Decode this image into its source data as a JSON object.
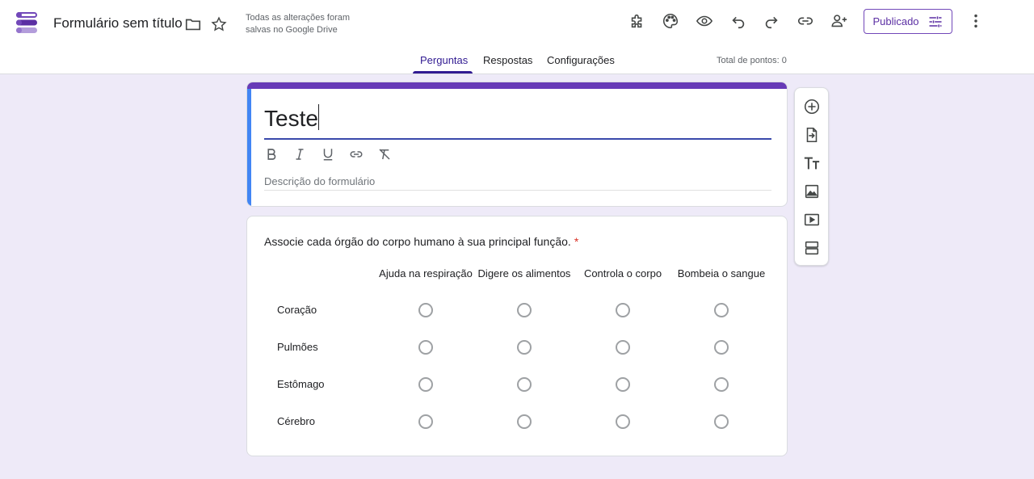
{
  "header": {
    "title": "Formulário sem título",
    "save_status": "Todas as alterações foram salvas no Google Drive",
    "publish_label": "Publicado",
    "icons": [
      "forms-logo-icon",
      "folder-icon",
      "star-icon",
      "addon-icon",
      "palette-icon",
      "preview-icon",
      "undo-icon",
      "redo-icon",
      "link-icon",
      "add-collaborator-icon",
      "settings-sliders-icon",
      "more-vert-icon"
    ],
    "accent_color": "#673ab7"
  },
  "tabs": {
    "items": [
      {
        "label": "Perguntas",
        "active": true
      },
      {
        "label": "Respostas",
        "active": false
      },
      {
        "label": "Configurações",
        "active": false
      }
    ],
    "total_points": "Total de pontos: 0"
  },
  "form": {
    "title": "Teste",
    "description_placeholder": "Descrição do formulário",
    "format_icons": [
      "bold-icon",
      "italic-icon",
      "underline-icon",
      "link-icon",
      "clear-format-icon"
    ]
  },
  "question": {
    "text": "Associe cada órgão do corpo humano à sua principal função.",
    "required_mark": "*",
    "columns": [
      "Ajuda na respiração",
      "Digere os alimentos",
      "Controla o corpo",
      "Bombeia o sangue"
    ],
    "rows": [
      "Coração",
      "Pulmões",
      "Estômago",
      "Cérebro"
    ]
  },
  "toolbar": {
    "icons": [
      "add-question-icon",
      "import-questions-icon",
      "add-title-icon",
      "add-image-icon",
      "add-video-icon",
      "add-section-icon"
    ]
  }
}
